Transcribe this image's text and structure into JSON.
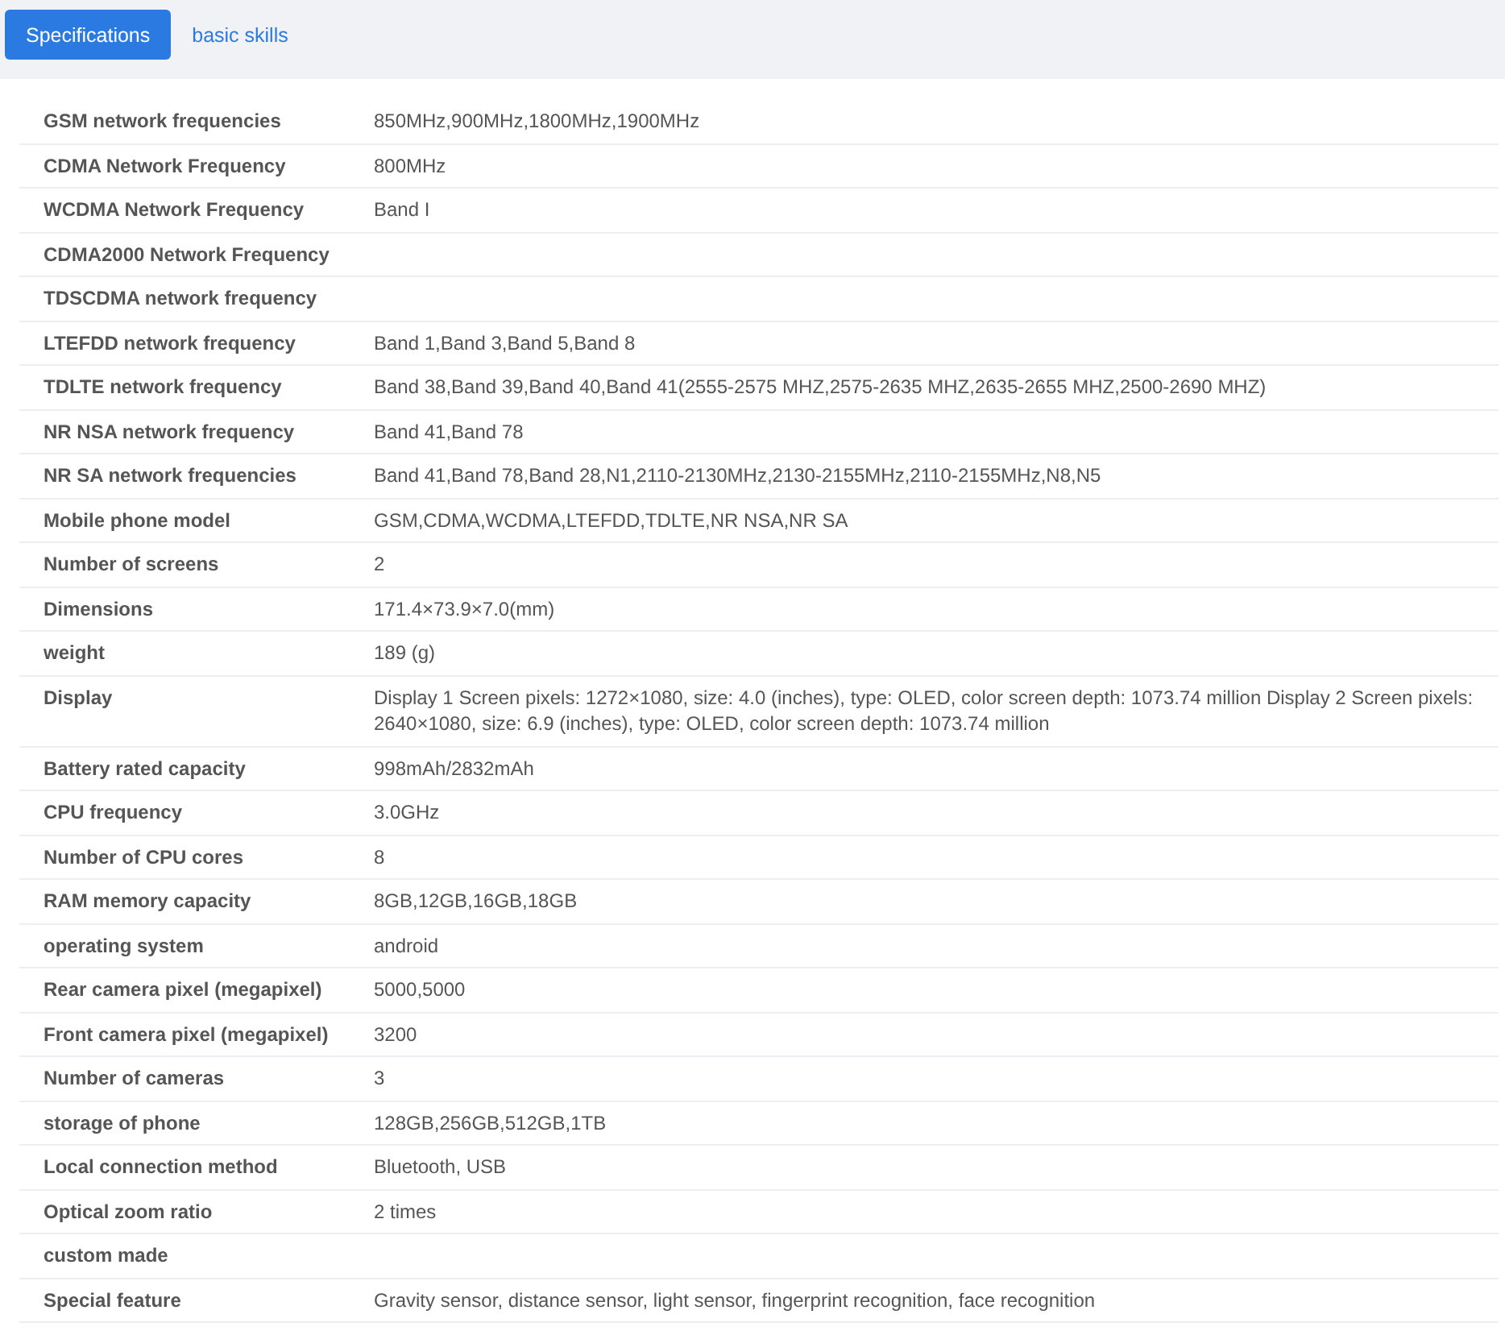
{
  "tabs": [
    {
      "label": "Specifications",
      "selected": true
    },
    {
      "label": "basic skills",
      "selected": false
    }
  ],
  "specs": [
    {
      "label": "GSM network frequencies",
      "value": "850MHz,900MHz,1800MHz,1900MHz"
    },
    {
      "label": "CDMA Network Frequency",
      "value": "800MHz"
    },
    {
      "label": "WCDMA Network Frequency",
      "value": "Band I"
    },
    {
      "label": "CDMA2000 Network Frequency"
    },
    {
      "label": "TDSCDMA network frequency"
    },
    {
      "label": "LTEFDD network frequency",
      "value": "Band 1,Band 3,Band 5,Band 8"
    },
    {
      "label": "TDLTE network frequency",
      "value": "Band 38,Band 39,Band 40,Band 41(2555-2575 MHZ,2575-2635 MHZ,2635-2655 MHZ,2500-2690 MHZ)"
    },
    {
      "label": "NR NSA network frequency",
      "value": "Band 41,Band 78"
    },
    {
      "label": "NR SA network frequencies",
      "value": "Band 41,Band 78,Band 28,N1,2110-2130MHz,2130-2155MHz,2110-2155MHz,N8,N5"
    },
    {
      "label": "Mobile phone model",
      "value": "GSM,CDMA,WCDMA,LTEFDD,TDLTE,NR NSA,NR SA"
    },
    {
      "label": "Number of screens",
      "value": "2"
    },
    {
      "label": "Dimensions",
      "value": "171.4×73.9×7.0(mm)"
    },
    {
      "label": "weight",
      "value": "189 (g)"
    },
    {
      "label": "Display",
      "value": "Display 1 Screen pixels: 1272×1080, size: 4.0 (inches), type: OLED, color screen depth: 1073.74 million Display 2 Screen pixels: 2640×1080, size: 6.9 (inches), type: OLED, color screen depth: 1073.74 million"
    },
    {
      "label": "Battery rated capacity",
      "value": "998mAh/2832mAh"
    },
    {
      "label": "CPU frequency",
      "value": "3.0GHz"
    },
    {
      "label": "Number of CPU cores",
      "value": "8"
    },
    {
      "label": "RAM memory capacity",
      "value": "8GB,12GB,16GB,18GB"
    },
    {
      "label": "operating system",
      "value": "android"
    },
    {
      "label": "Rear camera pixel (megapixel)",
      "value": "5000,5000"
    },
    {
      "label": "Front camera pixel (megapixel)",
      "value": "3200"
    },
    {
      "label": "Number of cameras",
      "value": "3"
    },
    {
      "label": "storage of phone",
      "value": "128GB,256GB,512GB,1TB"
    },
    {
      "label": "Local connection method",
      "value": "Bluetooth, USB"
    },
    {
      "label": "Optical zoom ratio",
      "value": "2 times"
    },
    {
      "label": "custom made"
    },
    {
      "label": "Special feature",
      "value": "Gravity sensor, distance sensor, light sensor, fingerprint recognition, face recognition"
    }
  ]
}
